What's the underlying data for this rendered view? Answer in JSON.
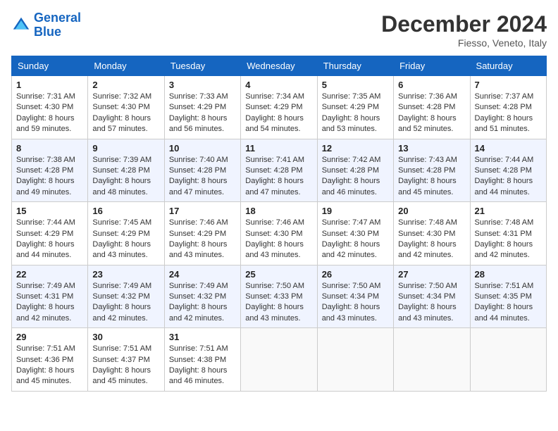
{
  "header": {
    "logo_line1": "General",
    "logo_line2": "Blue",
    "month_title": "December 2024",
    "location": "Fiesso, Veneto, Italy"
  },
  "weekdays": [
    "Sunday",
    "Monday",
    "Tuesday",
    "Wednesday",
    "Thursday",
    "Friday",
    "Saturday"
  ],
  "weeks": [
    [
      {
        "day": "1",
        "sunrise": "7:31 AM",
        "sunset": "4:30 PM",
        "daylight": "8 hours and 59 minutes."
      },
      {
        "day": "2",
        "sunrise": "7:32 AM",
        "sunset": "4:30 PM",
        "daylight": "8 hours and 57 minutes."
      },
      {
        "day": "3",
        "sunrise": "7:33 AM",
        "sunset": "4:29 PM",
        "daylight": "8 hours and 56 minutes."
      },
      {
        "day": "4",
        "sunrise": "7:34 AM",
        "sunset": "4:29 PM",
        "daylight": "8 hours and 54 minutes."
      },
      {
        "day": "5",
        "sunrise": "7:35 AM",
        "sunset": "4:29 PM",
        "daylight": "8 hours and 53 minutes."
      },
      {
        "day": "6",
        "sunrise": "7:36 AM",
        "sunset": "4:28 PM",
        "daylight": "8 hours and 52 minutes."
      },
      {
        "day": "7",
        "sunrise": "7:37 AM",
        "sunset": "4:28 PM",
        "daylight": "8 hours and 51 minutes."
      }
    ],
    [
      {
        "day": "8",
        "sunrise": "7:38 AM",
        "sunset": "4:28 PM",
        "daylight": "8 hours and 49 minutes."
      },
      {
        "day": "9",
        "sunrise": "7:39 AM",
        "sunset": "4:28 PM",
        "daylight": "8 hours and 48 minutes."
      },
      {
        "day": "10",
        "sunrise": "7:40 AM",
        "sunset": "4:28 PM",
        "daylight": "8 hours and 47 minutes."
      },
      {
        "day": "11",
        "sunrise": "7:41 AM",
        "sunset": "4:28 PM",
        "daylight": "8 hours and 47 minutes."
      },
      {
        "day": "12",
        "sunrise": "7:42 AM",
        "sunset": "4:28 PM",
        "daylight": "8 hours and 46 minutes."
      },
      {
        "day": "13",
        "sunrise": "7:43 AM",
        "sunset": "4:28 PM",
        "daylight": "8 hours and 45 minutes."
      },
      {
        "day": "14",
        "sunrise": "7:44 AM",
        "sunset": "4:28 PM",
        "daylight": "8 hours and 44 minutes."
      }
    ],
    [
      {
        "day": "15",
        "sunrise": "7:44 AM",
        "sunset": "4:29 PM",
        "daylight": "8 hours and 44 minutes."
      },
      {
        "day": "16",
        "sunrise": "7:45 AM",
        "sunset": "4:29 PM",
        "daylight": "8 hours and 43 minutes."
      },
      {
        "day": "17",
        "sunrise": "7:46 AM",
        "sunset": "4:29 PM",
        "daylight": "8 hours and 43 minutes."
      },
      {
        "day": "18",
        "sunrise": "7:46 AM",
        "sunset": "4:30 PM",
        "daylight": "8 hours and 43 minutes."
      },
      {
        "day": "19",
        "sunrise": "7:47 AM",
        "sunset": "4:30 PM",
        "daylight": "8 hours and 42 minutes."
      },
      {
        "day": "20",
        "sunrise": "7:48 AM",
        "sunset": "4:30 PM",
        "daylight": "8 hours and 42 minutes."
      },
      {
        "day": "21",
        "sunrise": "7:48 AM",
        "sunset": "4:31 PM",
        "daylight": "8 hours and 42 minutes."
      }
    ],
    [
      {
        "day": "22",
        "sunrise": "7:49 AM",
        "sunset": "4:31 PM",
        "daylight": "8 hours and 42 minutes."
      },
      {
        "day": "23",
        "sunrise": "7:49 AM",
        "sunset": "4:32 PM",
        "daylight": "8 hours and 42 minutes."
      },
      {
        "day": "24",
        "sunrise": "7:49 AM",
        "sunset": "4:32 PM",
        "daylight": "8 hours and 42 minutes."
      },
      {
        "day": "25",
        "sunrise": "7:50 AM",
        "sunset": "4:33 PM",
        "daylight": "8 hours and 43 minutes."
      },
      {
        "day": "26",
        "sunrise": "7:50 AM",
        "sunset": "4:34 PM",
        "daylight": "8 hours and 43 minutes."
      },
      {
        "day": "27",
        "sunrise": "7:50 AM",
        "sunset": "4:34 PM",
        "daylight": "8 hours and 43 minutes."
      },
      {
        "day": "28",
        "sunrise": "7:51 AM",
        "sunset": "4:35 PM",
        "daylight": "8 hours and 44 minutes."
      }
    ],
    [
      {
        "day": "29",
        "sunrise": "7:51 AM",
        "sunset": "4:36 PM",
        "daylight": "8 hours and 45 minutes."
      },
      {
        "day": "30",
        "sunrise": "7:51 AM",
        "sunset": "4:37 PM",
        "daylight": "8 hours and 45 minutes."
      },
      {
        "day": "31",
        "sunrise": "7:51 AM",
        "sunset": "4:38 PM",
        "daylight": "8 hours and 46 minutes."
      },
      null,
      null,
      null,
      null
    ]
  ],
  "labels": {
    "sunrise": "Sunrise: ",
    "sunset": "Sunset: ",
    "daylight": "Daylight: "
  }
}
